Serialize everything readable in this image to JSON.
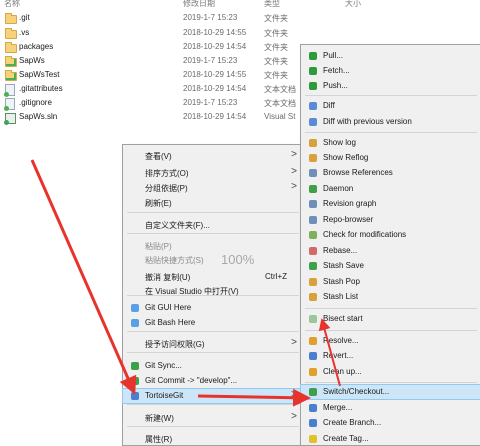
{
  "columns": [
    {
      "key": "name",
      "label": "名称"
    },
    {
      "key": "date",
      "label": "修改日期"
    },
    {
      "key": "type",
      "label": "类型"
    },
    {
      "key": "size",
      "label": "大小"
    }
  ],
  "files": [
    {
      "name": ".git",
      "date": "2019-1-7 15:23",
      "type": "文件夹",
      "icon": "folder-icon"
    },
    {
      "name": ".vs",
      "date": "2018-10-29 14:55",
      "type": "文件夹",
      "icon": "folder-icon"
    },
    {
      "name": "packages",
      "date": "2018-10-29 14:54",
      "type": "文件夹",
      "icon": "folder-icon"
    },
    {
      "name": "SapWs",
      "date": "2019-1-7 15:23",
      "type": "文件夹",
      "icon": "git-folder-icon"
    },
    {
      "name": "SapWsTest",
      "date": "2018-10-29 14:55",
      "type": "文件夹",
      "icon": "git-folder-icon"
    },
    {
      "name": ".gitattributes",
      "date": "2018-10-29 14:54",
      "type": "文本文档",
      "icon": "git-file-icon"
    },
    {
      "name": ".gitignore",
      "date": "2019-1-7 15:23",
      "type": "文本文档",
      "icon": "git-file-icon"
    },
    {
      "name": "SapWs.sln",
      "date": "2018-10-29 14:54",
      "type": "Visual St",
      "icon": "sln-file-icon"
    }
  ],
  "context_menu": {
    "items": [
      {
        "label": "查看(V)",
        "arrow": ">"
      },
      {
        "label": "排序方式(O)",
        "arrow": ">"
      },
      {
        "label": "分组依据(P)",
        "arrow": ">"
      },
      {
        "label": "刷新(E)"
      },
      {
        "label": "自定义文件夹(F)..."
      },
      {
        "label": "粘贴(P)",
        "disabled": true
      },
      {
        "label": "粘贴快捷方式(S)",
        "disabled": true,
        "extra": "100%"
      },
      {
        "label": "撤消 复制(U)",
        "accel": "Ctrl+Z"
      },
      {
        "label": "在 Visual Studio 中打开(V)"
      },
      {
        "label": "Git GUI Here",
        "icon": "git-gui-icon"
      },
      {
        "label": "Git Bash Here",
        "icon": "git-bash-icon"
      },
      {
        "label": "授予访问权限(G)",
        "arrow": ">"
      },
      {
        "label": "Git Sync...",
        "icon": "git-sync-icon"
      },
      {
        "label": "Git Commit -> \"develop\"...",
        "icon": "git-commit-icon"
      },
      {
        "label": "TortoiseGit",
        "arrow": ">",
        "icon": "tortoisegit-icon",
        "highlighted": true
      },
      {
        "label": "新建(W)",
        "arrow": ">"
      },
      {
        "label": "属性(R)"
      }
    ]
  },
  "tortoise_menu": {
    "items": [
      {
        "label": "Pull...",
        "icon": "pull-icon",
        "color": "#2e9a3a"
      },
      {
        "label": "Fetch...",
        "icon": "fetch-icon",
        "color": "#2e9a3a"
      },
      {
        "label": "Push...",
        "icon": "push-icon",
        "color": "#2e9a3a"
      },
      {
        "label": "Diff",
        "icon": "diff-icon",
        "color": "#5b8bd6"
      },
      {
        "label": "Diff with previous version",
        "icon": "diff-previous-icon",
        "color": "#5b8bd6"
      },
      {
        "label": "Show log",
        "icon": "show-log-icon",
        "color": "#d9a13b"
      },
      {
        "label": "Show Reflog",
        "icon": "show-reflog-icon",
        "color": "#d9a13b"
      },
      {
        "label": "Browse References",
        "icon": "browse-references-icon",
        "color": "#6f8fb8"
      },
      {
        "label": "Daemon",
        "icon": "daemon-icon",
        "color": "#3ea04a"
      },
      {
        "label": "Revision graph",
        "icon": "revision-graph-icon",
        "color": "#6f8fb8"
      },
      {
        "label": "Repo-browser",
        "icon": "repo-browser-icon",
        "color": "#6f8fb8"
      },
      {
        "label": "Check for modifications",
        "icon": "check-modifications-icon",
        "color": "#7fb05a"
      },
      {
        "label": "Rebase...",
        "icon": "rebase-icon",
        "color": "#d26a6a"
      },
      {
        "label": "Stash Save",
        "icon": "stash-save-icon",
        "color": "#3ea04a"
      },
      {
        "label": "Stash Pop",
        "icon": "stash-pop-icon",
        "color": "#d9a13b"
      },
      {
        "label": "Stash List",
        "icon": "stash-list-icon",
        "color": "#d9a13b"
      },
      {
        "label": "Bisect start",
        "icon": "bisect-start-icon",
        "color": "#9cc59a"
      },
      {
        "label": "Resolve...",
        "icon": "resolve-icon",
        "color": "#e0a12c"
      },
      {
        "label": "Revert...",
        "icon": "revert-icon",
        "color": "#4a7fd0"
      },
      {
        "label": "Clean up...",
        "icon": "clean-up-icon",
        "color": "#e0a12c"
      },
      {
        "label": "Switch/Checkout...",
        "icon": "switch-checkout-icon",
        "color": "#3ea04a",
        "highlighted": true
      },
      {
        "label": "Merge...",
        "icon": "merge-icon",
        "color": "#4a7fd0"
      },
      {
        "label": "Create Branch...",
        "icon": "create-branch-icon",
        "color": "#4a7fd0"
      },
      {
        "label": "Create Tag...",
        "icon": "create-tag-icon",
        "color": "#e0c12c"
      }
    ]
  },
  "annotation_color": "#e8332d"
}
